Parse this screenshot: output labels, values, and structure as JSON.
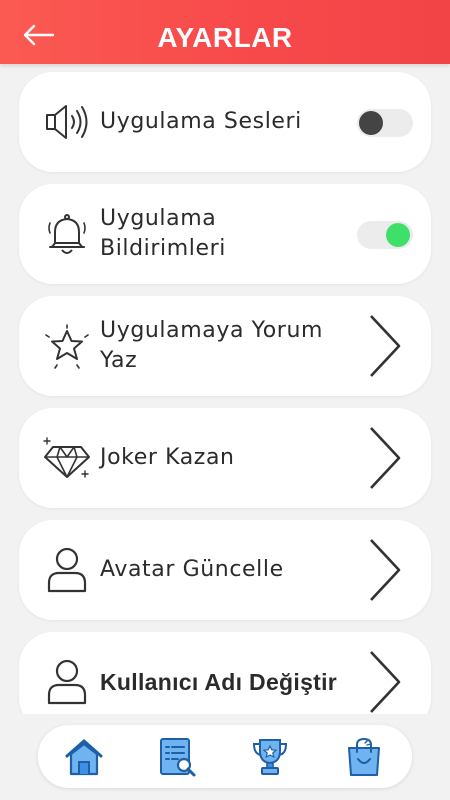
{
  "header": {
    "title": "AYARLAR",
    "back_icon": "arrow-left-icon"
  },
  "settings": [
    {
      "label": "Uygulama Sesleri",
      "icon": "speaker-icon",
      "control": "toggle",
      "enabled": false
    },
    {
      "label": "Uygulama Bildirimleri",
      "icon": "bell-icon",
      "control": "toggle",
      "enabled": true
    },
    {
      "label": "Uygulamaya Yorum Yaz",
      "icon": "star-icon",
      "control": "chevron"
    },
    {
      "label": "Joker Kazan",
      "icon": "diamond-icon",
      "control": "chevron"
    },
    {
      "label": "Avatar Güncelle",
      "icon": "user-icon",
      "control": "chevron"
    },
    {
      "label": "Kullanıcı Adı Değiştir",
      "icon": "user-icon",
      "control": "chevron"
    }
  ],
  "bottom_nav": [
    {
      "icon": "home-icon"
    },
    {
      "icon": "search-list-icon"
    },
    {
      "icon": "trophy-icon"
    },
    {
      "icon": "shopping-bag-icon"
    }
  ],
  "colors": {
    "header": "#f7484a",
    "toggle_on": "#3fe06a",
    "toggle_off_knob": "#444444",
    "nav_icon": "#3d8ee6"
  }
}
